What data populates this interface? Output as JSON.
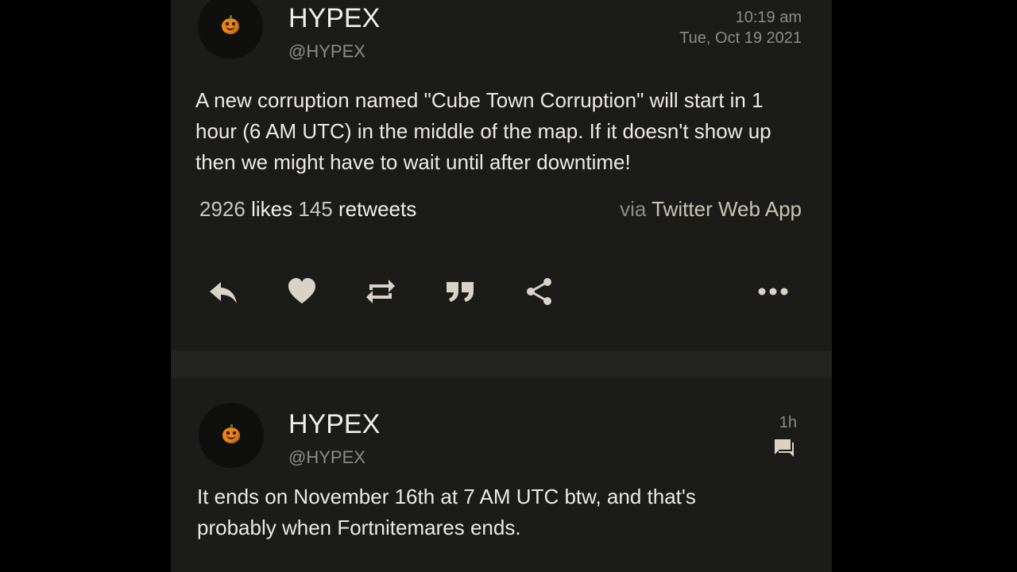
{
  "tweets": [
    {
      "name": "HYPEX",
      "handle": "@HYPEX",
      "time": "10:19 am",
      "date": "Tue, Oct 19 2021",
      "text_lines": [
        "A new corruption named \"Cube Town Corruption\" will start in 1",
        "hour (6 AM UTC) in the middle of the map. If it doesn't show up",
        "then we might have to wait until after downtime!"
      ],
      "likes_count": "2926",
      "likes_label": "likes",
      "retweets_count": "145",
      "retweets_label": "retweets",
      "via_prefix": "via",
      "via_app": "Twitter Web App",
      "avatar_icon": "pumpkin-icon"
    },
    {
      "name": "HYPEX",
      "handle": "@HYPEX",
      "time": "1h",
      "text_lines": [
        "It ends on November 16th at 7 AM UTC btw, and that's",
        "probably when Fortnitemares ends."
      ],
      "avatar_icon": "pumpkin-icon",
      "status_icon": "message-icon"
    }
  ],
  "actions": [
    "reply-icon",
    "heart-icon",
    "retweet-icon",
    "quote-icon",
    "share-icon",
    "more-icon"
  ],
  "colors": {
    "background": "#000000",
    "panel": "#1b1c19",
    "divider": "#23241f",
    "icon": "#d9d3c7",
    "muted": "#8d8b85"
  }
}
